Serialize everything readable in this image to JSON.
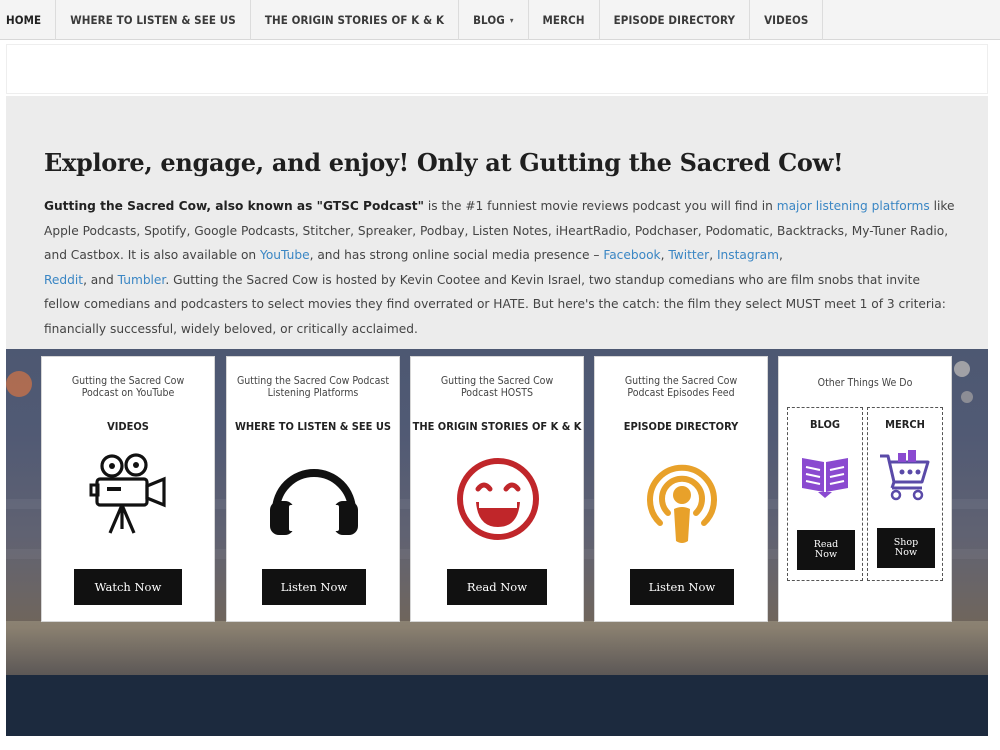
{
  "nav": {
    "items": [
      {
        "label": "HOME"
      },
      {
        "label": "WHERE TO LISTEN & SEE US"
      },
      {
        "label": "THE ORIGIN STORIES OF K & K"
      },
      {
        "label": "BLOG",
        "caret": "▾"
      },
      {
        "label": "MERCH"
      },
      {
        "label": "EPISODE DIRECTORY"
      },
      {
        "label": "VIDEOS"
      }
    ]
  },
  "main": {
    "headline": "Explore, engage, and enjoy! Only at Gutting the Sacred Cow!",
    "intro": {
      "bold": "Gutting the Sacred Cow, also known as \"GTSC Podcast\"",
      "t1": " is the #1 funniest movie reviews podcast you will find in ",
      "l1": "major listening platforms",
      "t2": " like Apple Podcasts, Spotify, Google Podcasts, Stitcher, Spreaker, Podbay, Listen Notes, iHeartRadio, Podchaser, Podomatic, Backtracks, My-Tuner Radio, and Castbox. It is also available on ",
      "l2": "YouTube",
      "t3": ", and has strong online social media presence – ",
      "l3": "Facebook",
      "t4": ", ",
      "l4": "Twitter",
      "t5": ", ",
      "l5": "Instagram",
      "t6": ",",
      "l6": "Reddit",
      "t7": ", and ",
      "l7": "Tumbler",
      "t8": ". Gutting the Sacred Cow is hosted by Kevin Cootee and Kevin Israel, two standup comedians who are film snobs that invite fellow comedians and podcasters to select movies they find overrated or HATE. But here's the catch: the film they select MUST meet 1 of 3 criteria: financially successful, widely beloved, or critically acclaimed."
    }
  },
  "cards": [
    {
      "title": "Gutting the Sacred Cow Podcast on YouTube",
      "heading": "VIDEOS",
      "button": "Watch Now",
      "icon": "video-camera-icon"
    },
    {
      "title": "Gutting the Sacred Cow Podcast Listening Platforms",
      "heading": "WHERE TO LISTEN & SEE US",
      "button": "Listen Now",
      "icon": "headphones-icon"
    },
    {
      "title": "Gutting the Sacred Cow Podcast HOSTS",
      "heading": "THE ORIGIN STORIES OF K & K",
      "button": "Read Now",
      "icon": "laughing-face-icon"
    },
    {
      "title": "Gutting the Sacred Cow Podcast Episodes Feed",
      "heading": "EPISODE DIRECTORY",
      "button": "Listen Now",
      "icon": "podcast-icon"
    }
  ],
  "other": {
    "title": "Other Things We Do",
    "blog": {
      "heading": "BLOG",
      "button": "Read Now",
      "icon": "open-book-icon"
    },
    "merch": {
      "heading": "MERCH",
      "button": "Shop Now",
      "icon": "shopping-cart-icon"
    }
  },
  "colors": {
    "link": "#3a86c4",
    "face_red": "#c0262a",
    "podcast_orange": "#e8a12a",
    "book_purple": "#8a4ad0",
    "cart_purple": "#5a4aa8"
  }
}
